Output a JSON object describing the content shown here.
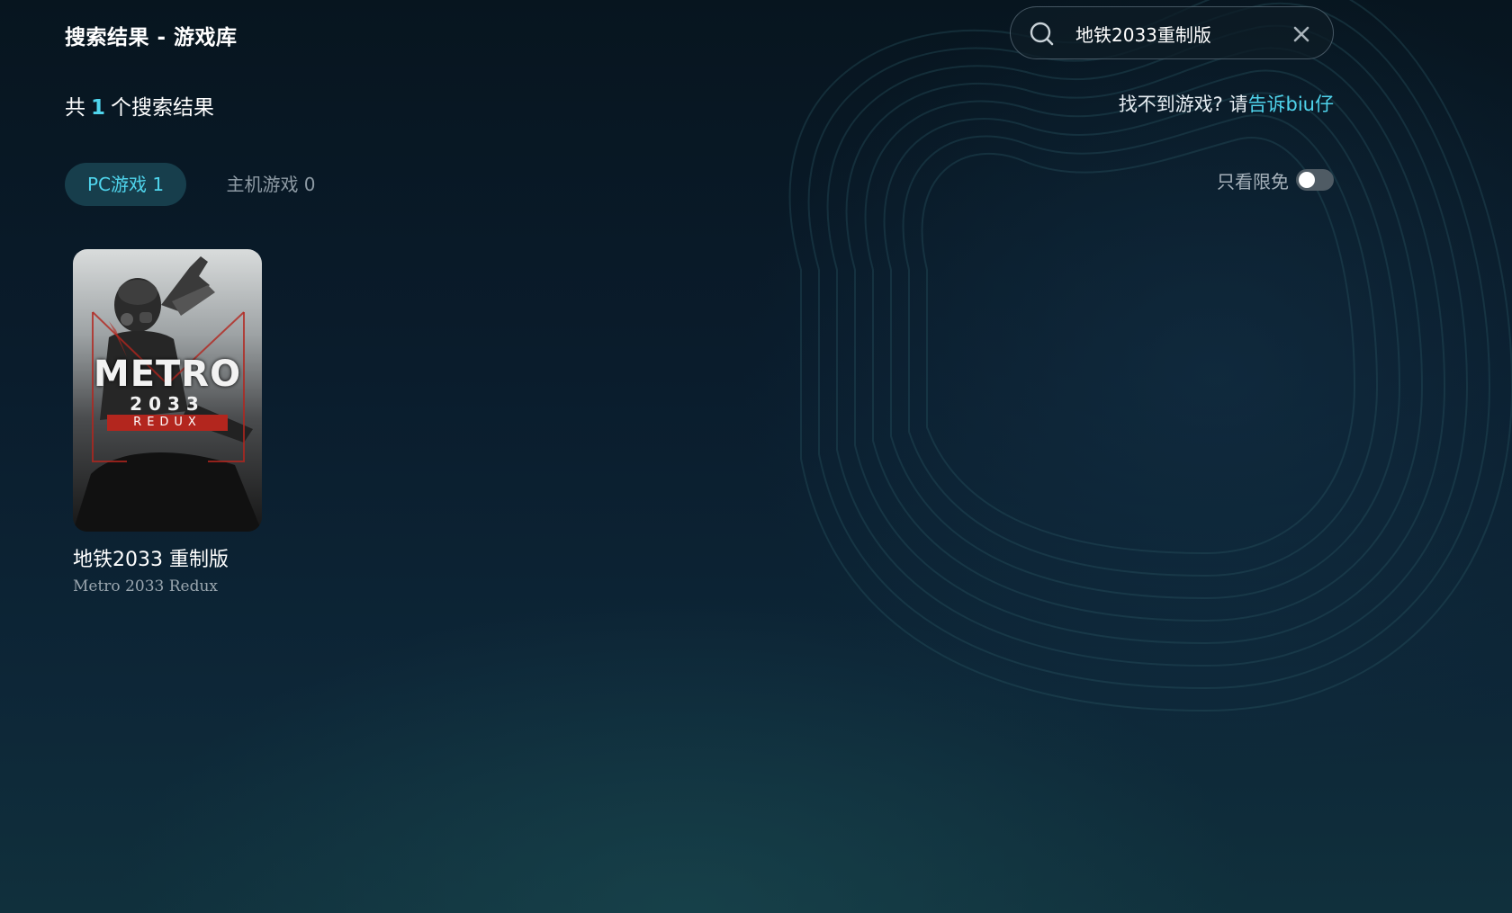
{
  "header": {
    "title": "搜索结果 - 游戏库",
    "result_prefix": "共",
    "result_count": "1",
    "result_suffix": "个搜索结果"
  },
  "search": {
    "value": "地铁2033重制版",
    "icon": "search-icon",
    "clear_icon": "close-icon"
  },
  "report": {
    "prompt": "找不到游戏? 请",
    "link": "告诉biu仔"
  },
  "tabs": [
    {
      "label": "PC游戏 1",
      "active": true
    },
    {
      "label": "主机游戏 0",
      "active": false
    }
  ],
  "filter": {
    "label": "只看限免",
    "enabled": false
  },
  "results": [
    {
      "name": "地铁2033 重制版",
      "subname": "Metro 2033 Redux",
      "cover_title": "METRO",
      "cover_year": "2033",
      "cover_edition": "REDUX"
    }
  ],
  "colors": {
    "accent": "#4fd4ec",
    "tab_active_bg": "#173e4c",
    "muted_text": "#8d9aa4",
    "background": "#0a1c2c",
    "cover_red": "#b3261e"
  }
}
